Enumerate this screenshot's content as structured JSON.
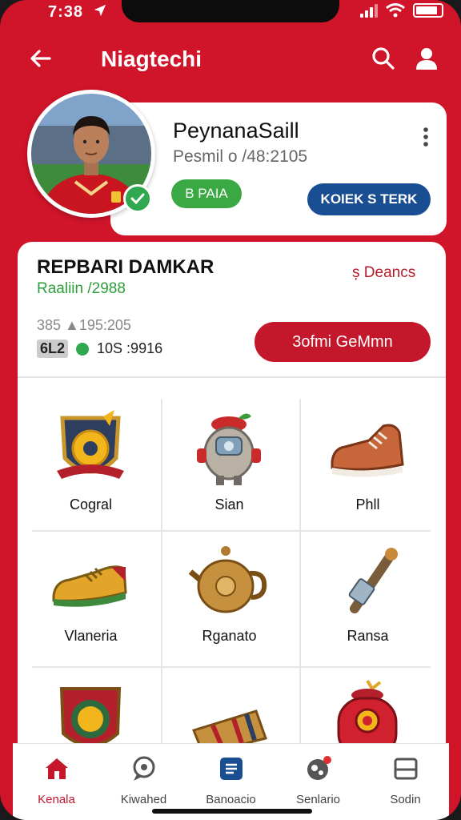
{
  "status_bar": {
    "time": "7:38"
  },
  "app_bar": {
    "title": "Niagtechi"
  },
  "profile": {
    "name": "PeynanaSaill",
    "subtitle": "Pesmil o /48:2105",
    "status_label": "B PAIA",
    "action_label": "KOIEK S TERK"
  },
  "summary": {
    "title": "REPBARI DAMKAR",
    "subtitle": "Raaliin /2988",
    "details_link": "Deancs",
    "stat_1": "385  ▲195:205",
    "stat_chip": "6L2",
    "stat_2": "10S :9916",
    "primary_button": "3ofmi GeMmn"
  },
  "grid": {
    "items": [
      {
        "label": "Cogral",
        "icon": "shield-emblem-icon"
      },
      {
        "label": "Sian",
        "icon": "robot-pot-icon"
      },
      {
        "label": "Phll",
        "icon": "sneaker-icon"
      },
      {
        "label": "Vlaneria",
        "icon": "boot-icon"
      },
      {
        "label": "Rganato",
        "icon": "kettle-icon"
      },
      {
        "label": "Ransa",
        "icon": "bat-icon"
      },
      {
        "label": "",
        "icon": "shield-ball-icon"
      },
      {
        "label": "",
        "icon": "scroll-icon"
      },
      {
        "label": "",
        "icon": "red-robot-icon"
      }
    ]
  },
  "bottom_nav": {
    "items": [
      {
        "label": "Kenala",
        "active": true
      },
      {
        "label": "Kiwahed",
        "active": false
      },
      {
        "label": "Banoacio",
        "active": false
      },
      {
        "label": "Senlario",
        "active": false
      },
      {
        "label": "Sodin",
        "active": false
      }
    ]
  },
  "colors": {
    "brand_red": "#d0142a",
    "button_blue": "#1a4e93",
    "success_green": "#3aa843"
  }
}
